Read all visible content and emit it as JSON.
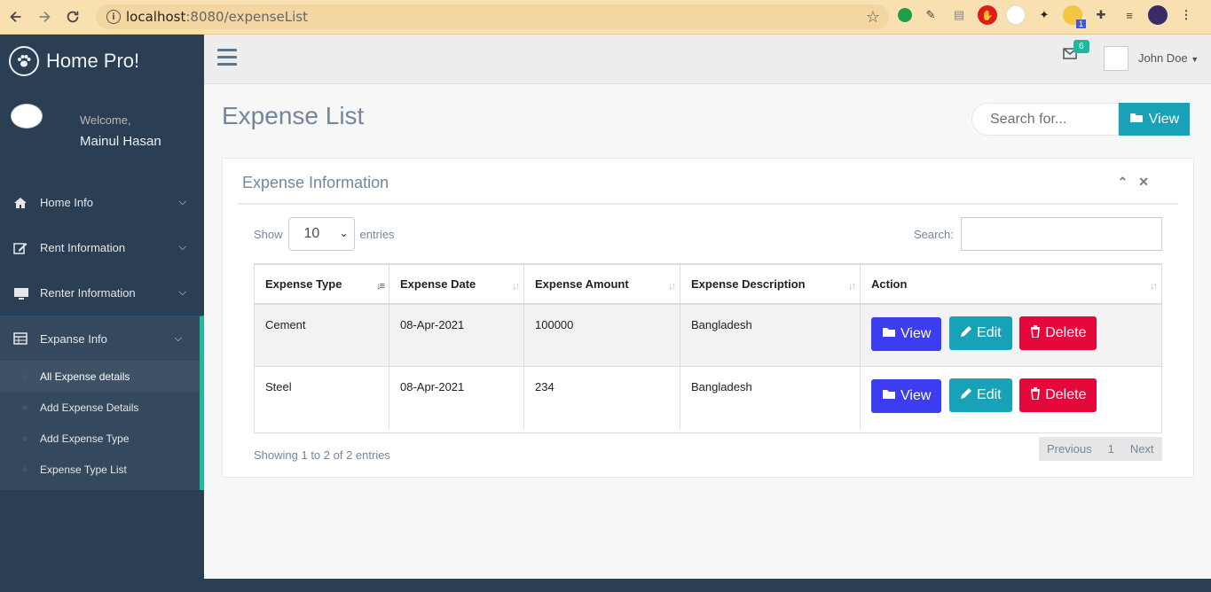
{
  "browser": {
    "url_host": "localhost",
    "url_path": ":8080/expenseList",
    "ext_badge": "1"
  },
  "sidebar": {
    "brand": "Home Pro!",
    "welcome": "Welcome,",
    "username": "Mainul Hasan",
    "items": [
      {
        "label": "Home Info",
        "icon": "home-icon"
      },
      {
        "label": "Rent Information",
        "icon": "edit-icon"
      },
      {
        "label": "Renter Information",
        "icon": "desktop-icon"
      },
      {
        "label": "Expanse Info",
        "icon": "table-icon"
      }
    ],
    "subitems": [
      {
        "label": "All Expense details"
      },
      {
        "label": "Add Expense Details"
      },
      {
        "label": "Add Expense Type"
      },
      {
        "label": "Expense Type List"
      }
    ]
  },
  "topnav": {
    "mail_count": "6",
    "user_name": "John Doe"
  },
  "main": {
    "page_title": "Expense List",
    "search_placeholder": "Search for...",
    "search_button": "View",
    "panel_title": "Expense Information",
    "show_label": "Show",
    "entries_value": "10",
    "entries_label": "entries",
    "search_label": "Search:",
    "table": {
      "headers": [
        "Expense Type",
        "Expense Date",
        "Expense Amount",
        "Expense Description",
        "Action"
      ],
      "rows": [
        {
          "type": "Cement",
          "date": "08-Apr-2021",
          "amount": "100000",
          "description": "Bangladesh"
        },
        {
          "type": "Steel",
          "date": "08-Apr-2021",
          "amount": "234",
          "description": "Bangladesh"
        }
      ],
      "actions": {
        "view": "View",
        "edit": "Edit",
        "delete": "Delete"
      }
    },
    "showing": "Showing 1 to 2 of 2 entries",
    "pager": {
      "previous": "Previous",
      "page": "1",
      "next": "Next"
    }
  },
  "colors": {
    "sidebar_bg": "#2a3f54",
    "accent": "#1abb9c",
    "view_btn": "#3c3cf0",
    "edit_btn": "#17a2b8",
    "delete_btn": "#e4083b"
  }
}
